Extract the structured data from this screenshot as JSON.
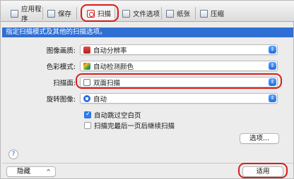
{
  "tabs": [
    {
      "label": "应用程序"
    },
    {
      "label": "保存"
    },
    {
      "label": "扫描"
    },
    {
      "label": "文件选项"
    },
    {
      "label": "纸张"
    },
    {
      "label": "压缩"
    }
  ],
  "header": {
    "description": "指定扫描模式及其他的扫描选项。"
  },
  "settings": {
    "image_quality": {
      "label": "图像画质:",
      "value": "自动分辨率"
    },
    "color_mode": {
      "label": "色彩模式:",
      "value": "自动检测颜色"
    },
    "scan_side": {
      "label": "扫描面:",
      "value": "双面扫描"
    },
    "rotate": {
      "label": "旋转图像:",
      "value": "自动"
    }
  },
  "checkboxes": {
    "skip_blank": {
      "label": "自动跳过空白页",
      "checked": true
    },
    "continue_after_last": {
      "label": "扫描完最后一页后继续扫描",
      "checked": false
    }
  },
  "buttons": {
    "options": "选项...",
    "hide": "隐藏",
    "hide_chevron": "^",
    "apply": "适用",
    "help": "?"
  },
  "colors": {
    "accent_blue": "#2f6fd4",
    "highlight_red": "#d91e1e"
  }
}
